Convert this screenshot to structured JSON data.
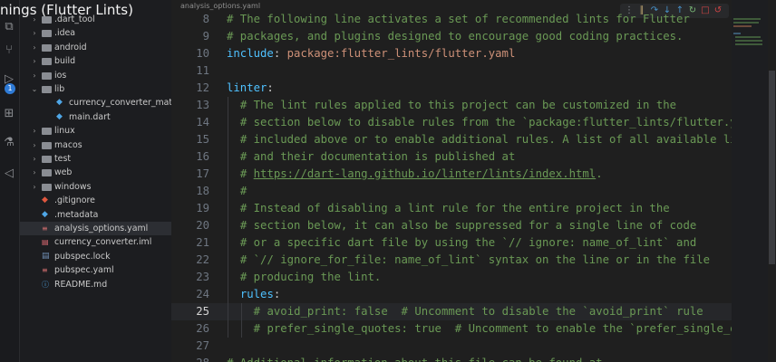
{
  "overlay_title": "nings (Flutter Lints)",
  "breadcrumb": "analysis_options.yaml",
  "activity": {
    "badge_count": "1",
    "icons": [
      "files-icon",
      "source-control-icon",
      "run-debug-icon",
      "extensions-icon",
      "testing-icon",
      "flutter-icon"
    ]
  },
  "explorer": {
    "items": [
      {
        "label": ".dart_tool",
        "kind": "folder",
        "depth": 1,
        "expanded": false
      },
      {
        "label": ".idea",
        "kind": "folder",
        "depth": 1,
        "expanded": false
      },
      {
        "label": "android",
        "kind": "folder",
        "depth": 1,
        "expanded": false
      },
      {
        "label": "build",
        "kind": "folder",
        "depth": 1,
        "expanded": false
      },
      {
        "label": "ios",
        "kind": "folder",
        "depth": 1,
        "expanded": false
      },
      {
        "label": "lib",
        "kind": "folder",
        "depth": 1,
        "expanded": true
      },
      {
        "label": "currency_converter_materi...",
        "kind": "dart",
        "depth": 2
      },
      {
        "label": "main.dart",
        "kind": "dart",
        "depth": 2
      },
      {
        "label": "linux",
        "kind": "folder",
        "depth": 1,
        "expanded": false
      },
      {
        "label": "macos",
        "kind": "folder",
        "depth": 1,
        "expanded": false
      },
      {
        "label": "test",
        "kind": "folder",
        "depth": 1,
        "expanded": false
      },
      {
        "label": "web",
        "kind": "folder",
        "depth": 1,
        "expanded": false
      },
      {
        "label": "windows",
        "kind": "folder",
        "depth": 1,
        "expanded": false
      },
      {
        "label": ".gitignore",
        "kind": "git",
        "depth": 1
      },
      {
        "label": ".metadata",
        "kind": "dart",
        "depth": 1
      },
      {
        "label": "analysis_options.yaml",
        "kind": "yaml",
        "depth": 1,
        "selected": true
      },
      {
        "label": "currency_converter.iml",
        "kind": "iml",
        "depth": 1
      },
      {
        "label": "pubspec.lock",
        "kind": "lock",
        "depth": 1
      },
      {
        "label": "pubspec.yaml",
        "kind": "yaml",
        "depth": 1
      },
      {
        "label": "README.md",
        "kind": "md",
        "depth": 1
      }
    ]
  },
  "editor": {
    "current_line": "25",
    "lines": [
      {
        "n": "8",
        "indent": 0,
        "segments": [
          {
            "t": "# The following line activates a set of recommended lints for Flutter",
            "c": "comment"
          }
        ]
      },
      {
        "n": "9",
        "indent": 0,
        "segments": [
          {
            "t": "# packages, and plugins designed to encourage good coding practices.",
            "c": "comment"
          }
        ]
      },
      {
        "n": "10",
        "indent": 0,
        "segments": [
          {
            "t": "include",
            "c": "key"
          },
          {
            "t": ": ",
            "c": "plain"
          },
          {
            "t": "package:flutter_lints/flutter.yaml",
            "c": "str"
          }
        ]
      },
      {
        "n": "11",
        "indent": 0,
        "segments": []
      },
      {
        "n": "12",
        "indent": 0,
        "segments": [
          {
            "t": "linter",
            "c": "key"
          },
          {
            "t": ":",
            "c": "plain"
          }
        ]
      },
      {
        "n": "13",
        "indent": 1,
        "segments": [
          {
            "t": "# The lint rules applied to this project can be customized in the",
            "c": "comment"
          }
        ]
      },
      {
        "n": "14",
        "indent": 1,
        "segments": [
          {
            "t": "# section below to disable rules from the `package:flutter_lints/flutter.yaml`",
            "c": "comment"
          }
        ]
      },
      {
        "n": "15",
        "indent": 1,
        "segments": [
          {
            "t": "# included above or to enable additional rules. A list of all available lints",
            "c": "comment"
          }
        ]
      },
      {
        "n": "16",
        "indent": 1,
        "segments": [
          {
            "t": "# and their documentation is published at",
            "c": "comment"
          }
        ]
      },
      {
        "n": "17",
        "indent": 1,
        "segments": [
          {
            "t": "# ",
            "c": "comment"
          },
          {
            "t": "https://dart-lang.github.io/linter/lints/index.html",
            "c": "link"
          },
          {
            "t": ".",
            "c": "comment"
          }
        ]
      },
      {
        "n": "18",
        "indent": 1,
        "segments": [
          {
            "t": "#",
            "c": "comment"
          }
        ]
      },
      {
        "n": "19",
        "indent": 1,
        "segments": [
          {
            "t": "# Instead of disabling a lint rule for the entire project in the",
            "c": "comment"
          }
        ]
      },
      {
        "n": "20",
        "indent": 1,
        "segments": [
          {
            "t": "# section below, it can also be suppressed for a single line of code",
            "c": "comment"
          }
        ]
      },
      {
        "n": "21",
        "indent": 1,
        "segments": [
          {
            "t": "# or a specific dart file by using the `// ignore: name_of_lint` and",
            "c": "comment"
          }
        ]
      },
      {
        "n": "22",
        "indent": 1,
        "segments": [
          {
            "t": "# `// ignore_for_file: name_of_lint` syntax on the line or in the file",
            "c": "comment"
          }
        ]
      },
      {
        "n": "23",
        "indent": 1,
        "segments": [
          {
            "t": "# producing the lint.",
            "c": "comment"
          }
        ]
      },
      {
        "n": "24",
        "indent": 1,
        "segments": [
          {
            "t": "rules",
            "c": "key"
          },
          {
            "t": ":",
            "c": "plain"
          }
        ]
      },
      {
        "n": "25",
        "indent": 2,
        "segments": [
          {
            "t": "# avoid_print: false  # Uncomment to disable the `avoid_print` rule",
            "c": "comment"
          }
        ]
      },
      {
        "n": "26",
        "indent": 2,
        "segments": [
          {
            "t": "# prefer_single_quotes: true  # Uncomment to enable the `prefer_single_quotes` rule",
            "c": "comment"
          }
        ]
      },
      {
        "n": "27",
        "indent": 0,
        "segments": []
      },
      {
        "n": "28",
        "indent": 0,
        "segments": [
          {
            "t": "# Additional information about this file can be found at",
            "c": "comment"
          }
        ]
      }
    ]
  },
  "colors": {
    "comment": "#6a9955",
    "key": "#4fc1ff",
    "string": "#ce9178",
    "badge": "#2f7bd6"
  }
}
